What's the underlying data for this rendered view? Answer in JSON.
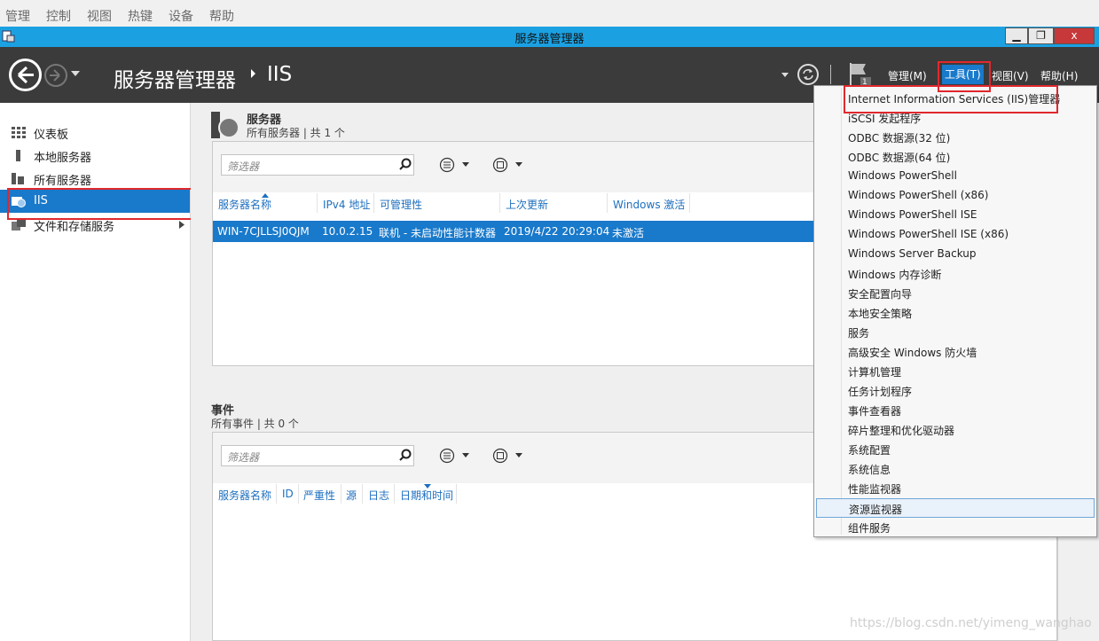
{
  "host_menu": [
    "管理",
    "控制",
    "视图",
    "热键",
    "设备",
    "帮助"
  ],
  "window": {
    "title": "服务器管理器",
    "minimize": "▁",
    "restore": "❐",
    "close": "x"
  },
  "header": {
    "breadcrumb_root": "服务器管理器",
    "breadcrumb_page": "IIS",
    "menus": {
      "manage": "管理(M)",
      "tools": "工具(T)",
      "view": "视图(V)",
      "help": "帮助(H)"
    },
    "flag_count": "1"
  },
  "nav": [
    {
      "label": "仪表板",
      "icon": "dashboard-icon"
    },
    {
      "label": "本地服务器",
      "icon": "local-server-icon"
    },
    {
      "label": "所有服务器",
      "icon": "all-servers-icon"
    },
    {
      "label": "IIS",
      "icon": "iis-icon"
    },
    {
      "label": "文件和存储服务",
      "icon": "file-storage-icon"
    }
  ],
  "servers_section": {
    "title": "服务器",
    "subtitle": "所有服务器 | 共 1 个",
    "filter_placeholder": "筛选器",
    "columns": [
      "服务器名称",
      "IPv4 地址",
      "可管理性",
      "上次更新",
      "Windows 激活"
    ],
    "rows": [
      [
        "WIN-7CJLLSJ0QJM",
        "10.0.2.15",
        "联机 - 未启动性能计数器",
        "2019/4/22 20:29:04",
        "未激活"
      ]
    ]
  },
  "events_section": {
    "title": "事件",
    "subtitle": "所有事件 | 共 0 个",
    "filter_placeholder": "筛选器",
    "columns": [
      "服务器名称",
      "ID",
      "严重性",
      "源",
      "日志",
      "日期和时间"
    ]
  },
  "tools_menu": [
    "Internet Information Services (IIS)管理器",
    "iSCSI 发起程序",
    "ODBC 数据源(32 位)",
    "ODBC 数据源(64 位)",
    "Windows PowerShell",
    "Windows PowerShell (x86)",
    "Windows PowerShell ISE",
    "Windows PowerShell ISE (x86)",
    "Windows Server Backup",
    "Windows 内存诊断",
    "安全配置向导",
    "本地安全策略",
    "服务",
    "高级安全 Windows 防火墙",
    "计算机管理",
    "任务计划程序",
    "事件查看器",
    "碎片整理和优化驱动器",
    "系统配置",
    "系统信息",
    "性能监视器",
    "资源监视器",
    "组件服务"
  ],
  "watermark": "https://blog.csdn.net/yimeng_wanghao",
  "colors": {
    "accent": "#1979ca",
    "titlebar": "#1ba1e2",
    "header": "#3b3b3b",
    "highlight_box": "#e0282e"
  }
}
